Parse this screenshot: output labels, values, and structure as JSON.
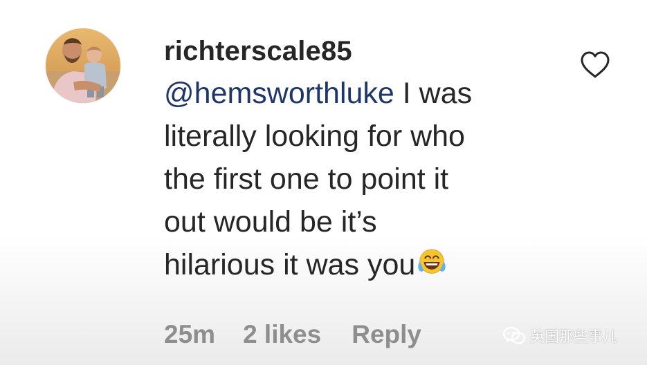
{
  "comment": {
    "username": "richterscale85",
    "mention": "@hemsworthluke",
    "lines": [
      " I was",
      "literally looking for who",
      "the first one to point it",
      "out would be it’s",
      "hilarious it was you"
    ],
    "emoji": "face-with-tears-of-joy",
    "time": "25m",
    "likes": "2 likes",
    "reply": "Reply"
  },
  "icons": {
    "like": "heart-outline-icon"
  },
  "watermark": {
    "text": "英国那些事儿"
  },
  "colors": {
    "text": "#262626",
    "mention": "#1e3768",
    "meta": "#8e8e8e"
  }
}
